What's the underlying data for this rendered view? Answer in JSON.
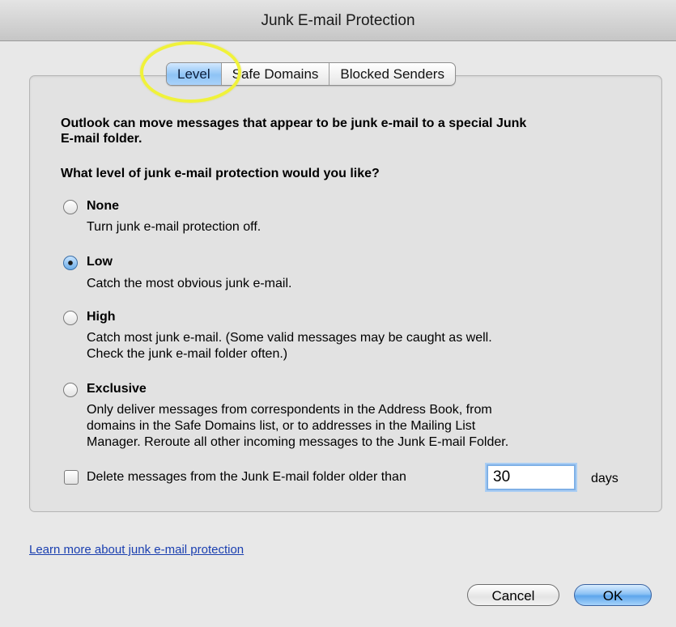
{
  "window": {
    "title": "Junk E-mail Protection"
  },
  "tabs": [
    {
      "label": "Level",
      "active": true
    },
    {
      "label": "Safe Domains",
      "active": false
    },
    {
      "label": "Blocked Senders",
      "active": false
    }
  ],
  "content": {
    "intro_line1": "Outlook can move messages that appear to be junk e-mail to a special Junk",
    "intro_line2": "E-mail folder.",
    "question": "What level of junk e-mail protection would you like?",
    "selected_option": "Low",
    "options": [
      {
        "label": "None",
        "desc_lines": [
          "Turn junk e-mail protection off."
        ]
      },
      {
        "label": "Low",
        "desc_lines": [
          "Catch the most obvious junk e-mail."
        ]
      },
      {
        "label": "High",
        "desc_lines": [
          "Catch most junk e-mail.  (Some valid messages may be caught as well.",
          "Check the junk e-mail folder often.)"
        ]
      },
      {
        "label": "Exclusive",
        "desc_lines": [
          "Only deliver messages from correspondents in the Address Book, from",
          "domains in the Safe Domains list, or to addresses in the Mailing List",
          "Manager.  Reroute all other incoming messages to the Junk E-mail Folder."
        ]
      }
    ],
    "delete_old": {
      "checked": false,
      "label": "Delete messages from the Junk E-mail folder older than",
      "value": "30",
      "unit": "days"
    }
  },
  "footer": {
    "learn_more_link": "Learn more about junk e-mail protection",
    "cancel_label": "Cancel",
    "ok_label": "OK"
  },
  "colors": {
    "accent": "#8ec3f5",
    "highlight_ring": "#f0f23a",
    "link": "#1a3fb0"
  }
}
